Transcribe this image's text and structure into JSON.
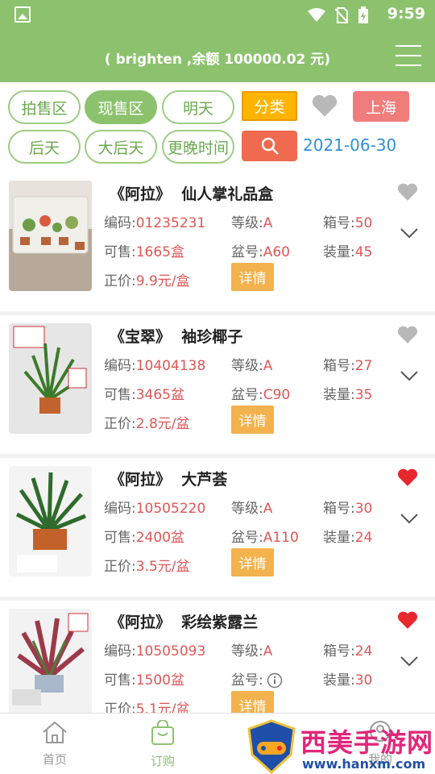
{
  "status_bar": {
    "time": "9:59"
  },
  "header": {
    "title": "( brighten ,余额 100000.02 元)"
  },
  "filters": {
    "tabs": [
      {
        "label": "拍售区",
        "active": false
      },
      {
        "label": "现售区",
        "active": true
      },
      {
        "label": "明天",
        "active": false
      },
      {
        "label": "后天",
        "active": false
      },
      {
        "label": "大后天",
        "active": false
      },
      {
        "label": "更晚时间",
        "active": false
      }
    ],
    "category_label": "分类",
    "city_label": "上海",
    "date": "2021-06-30"
  },
  "products": [
    {
      "name": "《阿拉》  仙人掌礼品盒",
      "code_label": "编码:",
      "code": "01235231",
      "grade_label": "等级:",
      "grade": "A",
      "box_label": "箱号:",
      "box": "50",
      "avail_label": "可售:",
      "avail": "1665盒",
      "pot_label": "盆号:",
      "pot": "A60",
      "qty_label": "装量:",
      "qty": "45",
      "price_label": "正价:",
      "price": "9.9元/盒",
      "detail_label": "详情",
      "favorited": false
    },
    {
      "name": "《宝翠》  袖珍椰子",
      "code_label": "编码:",
      "code": "10404138",
      "grade_label": "等级:",
      "grade": "A",
      "box_label": "箱号:",
      "box": "27",
      "avail_label": "可售:",
      "avail": "3465盆",
      "pot_label": "盆号:",
      "pot": "C90",
      "qty_label": "装量:",
      "qty": "35",
      "price_label": "正价:",
      "price": "2.8元/盆",
      "detail_label": "详情",
      "favorited": false
    },
    {
      "name": "《阿拉》  大芦荟",
      "code_label": "编码:",
      "code": "10505220",
      "grade_label": "等级:",
      "grade": "A",
      "box_label": "箱号:",
      "box": "30",
      "avail_label": "可售:",
      "avail": "2400盆",
      "pot_label": "盆号:",
      "pot": "A110",
      "qty_label": "装量:",
      "qty": "24",
      "price_label": "正价:",
      "price": "3.5元/盆",
      "detail_label": "详情",
      "favorited": true
    },
    {
      "name": "《阿拉》  彩绘紫露兰",
      "code_label": "编码:",
      "code": "10505093",
      "grade_label": "等级:",
      "grade": "A",
      "box_label": "箱号:",
      "box": "24",
      "avail_label": "可售:",
      "avail": "1500盆",
      "pot_label": "盆号:",
      "pot": "",
      "qty_label": "装量:",
      "qty": "30",
      "price_label": "正价:",
      "price": "5.1元/盆",
      "detail_label": "详情",
      "favorited": true
    }
  ],
  "tabbar": {
    "items": [
      {
        "label": "首页",
        "icon": "home-icon",
        "active": false
      },
      {
        "label": "订购",
        "icon": "shopping-bag-icon",
        "active": true
      },
      {
        "label": "我的",
        "icon": "user-icon",
        "active": false
      }
    ]
  },
  "watermark": {
    "brand": "西美手游网",
    "url": "www.hanxm.com"
  },
  "colors": {
    "primary_green": "#8cc26e",
    "price_red": "#e05555",
    "category_orange": "#ffb400",
    "city_red": "#f07c7c",
    "search_red": "#f06a4f",
    "date_blue": "#2f8fd8",
    "heart_red": "#e8272e",
    "heart_gray": "#b8b8b8",
    "detail_orange": "#f2b24d"
  }
}
